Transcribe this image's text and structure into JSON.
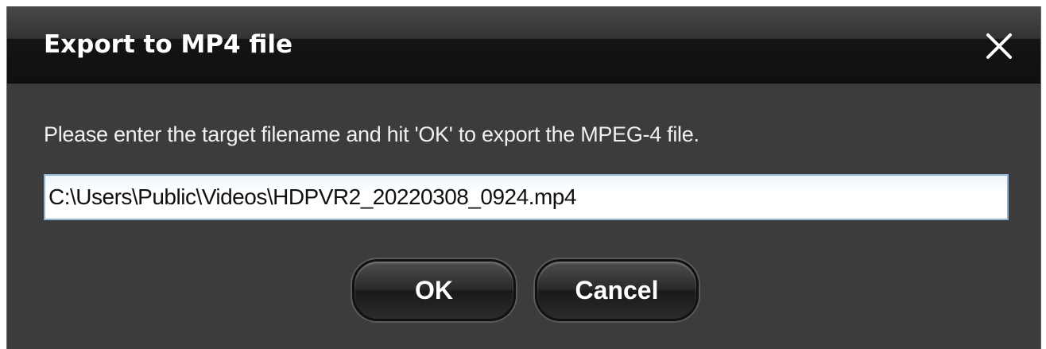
{
  "dialog": {
    "title": "Export to MP4 file",
    "close_icon": "close-icon",
    "message": "Please enter the target filename and hit 'OK' to export the MPEG-4 file.",
    "filename_value": "C:\\Users\\Public\\Videos\\HDPVR2_20220308_0924.mp4",
    "ok_label": "OK",
    "cancel_label": "Cancel"
  },
  "colors": {
    "background": "#3c3c3c",
    "titlebar": "#141414",
    "text": "#ffffff",
    "input_border": "#8fb4d4"
  }
}
